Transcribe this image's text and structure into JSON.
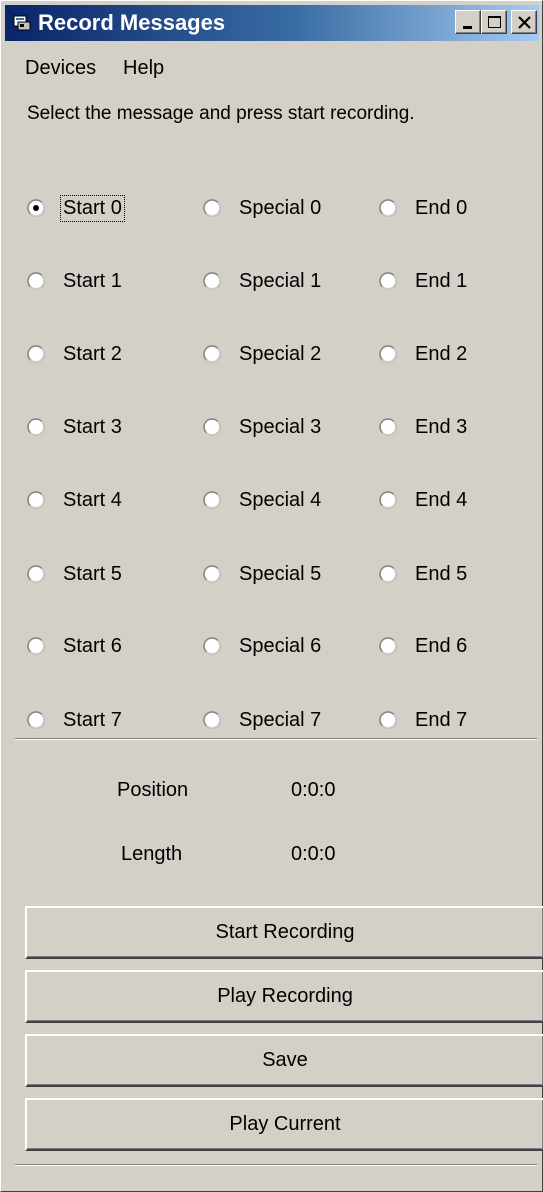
{
  "window": {
    "title": "Record Messages"
  },
  "menu": [
    {
      "label": "Devices"
    },
    {
      "label": "Help"
    }
  ],
  "instructions": "Select the message and press start recording.",
  "messages": {
    "start": [
      "Start 0",
      "Start 1",
      "Start 2",
      "Start 3",
      "Start 4",
      "Start 5",
      "Start 6",
      "Start 7"
    ],
    "special": [
      "Special 0",
      "Special 1",
      "Special 2",
      "Special 3",
      "Special 4",
      "Special 5",
      "Special 6",
      "Special 7"
    ],
    "end": [
      "End 0",
      "End 1",
      "End 2",
      "End 3",
      "End 4",
      "End 5",
      "End 6",
      "End 7"
    ],
    "selected": "Start 0"
  },
  "info": {
    "position_label": "Position",
    "position_value": "0:0:0",
    "length_label": "Length",
    "length_value": "0:0:0"
  },
  "buttons": {
    "start_recording": "Start Recording",
    "play_recording": "Play Recording",
    "save": "Save",
    "play_current": "Play Current"
  },
  "colors": {
    "face": "#d4d0c8",
    "title_start": "#0a246a",
    "title_end": "#a6caf0"
  },
  "icons": {
    "app": "app-icon",
    "minimize": "minimize-icon",
    "maximize": "maximize-icon",
    "close": "close-icon"
  }
}
